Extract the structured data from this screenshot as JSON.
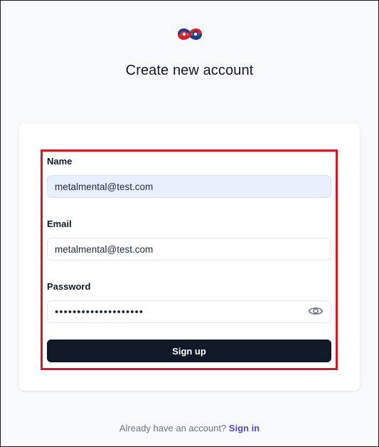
{
  "header": {
    "logo_icon": "knot-logo-icon",
    "title": "Create new account"
  },
  "form": {
    "name": {
      "label": "Name",
      "value": "metalmental@test.com"
    },
    "email": {
      "label": "Email",
      "value": "metalmental@test.com"
    },
    "password": {
      "label": "Password",
      "value": "••••••••••••••••••••",
      "toggle_icon": "eye-icon"
    },
    "submit_label": "Sign up"
  },
  "footer": {
    "prompt": "Already have an account?",
    "link_label": "Sign in"
  },
  "colors": {
    "highlight_border": "#e0141f",
    "button_bg": "#111827",
    "link": "#4f46e5"
  }
}
